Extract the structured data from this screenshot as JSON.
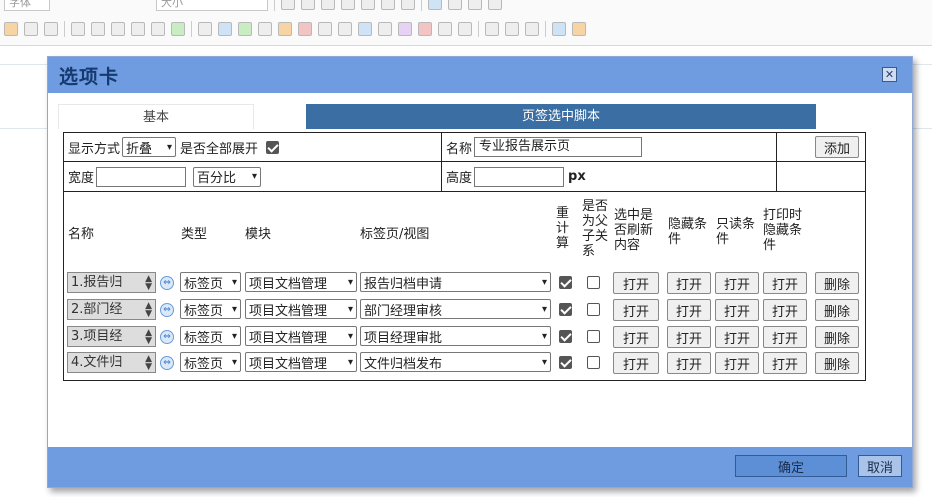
{
  "editor_toolbar": {
    "font_family_placeholder": "字体",
    "font_size_placeholder": "大小"
  },
  "dialog": {
    "title": "选项卡",
    "close_icon": "close-icon",
    "tabs": [
      {
        "label": "基本",
        "active": false
      },
      {
        "label": "页签选中脚本",
        "active": true
      }
    ],
    "settings": {
      "display_mode_label": "显示方式",
      "display_mode_value": "折叠",
      "expand_all_label": "是否全部展开",
      "expand_all_checked": true,
      "name_label": "名称",
      "name_value": "专业报告展示页",
      "add_label": "添加",
      "width_label": "宽度",
      "width_value": "",
      "width_unit_value": "百分比",
      "height_label": "高度",
      "height_value": "",
      "height_unit": "px"
    },
    "grid": {
      "headers": {
        "name": "名称",
        "type": "类型",
        "module": "模块",
        "tab_view": "标签页/视图",
        "recalc": "重\n计\n算",
        "parent_child": "是否\n为父\n子关\n系",
        "refresh_on_select": "选中是\n否刷新\n内容",
        "hide_cond": "隐藏条\n件",
        "readonly_cond": "只读条\n件",
        "print_hide_cond": "打印时\n隐藏条\n件"
      },
      "rows": [
        {
          "name": "1.报告归",
          "type": "标签页",
          "module": "项目文档管理",
          "view": "报告归档申请",
          "recalc": true,
          "parent_child": false,
          "open1": "打开",
          "open2": "打开",
          "open3": "打开",
          "open4": "打开",
          "delete": "删除"
        },
        {
          "name": "2.部门经",
          "type": "标签页",
          "module": "项目文档管理",
          "view": "部门经理审核",
          "recalc": true,
          "parent_child": false,
          "open1": "打开",
          "open2": "打开",
          "open3": "打开",
          "open4": "打开",
          "delete": "删除"
        },
        {
          "name": "3.项目经",
          "type": "标签页",
          "module": "项目文档管理",
          "view": "项目经理审批",
          "recalc": true,
          "parent_child": false,
          "open1": "打开",
          "open2": "打开",
          "open3": "打开",
          "open4": "打开",
          "delete": "删除"
        },
        {
          "name": "4.文件归",
          "type": "标签页",
          "module": "项目文档管理",
          "view": "文件归档发布",
          "recalc": true,
          "parent_child": false,
          "open1": "打开",
          "open2": "打开",
          "open3": "打开",
          "open4": "打开",
          "delete": "删除"
        }
      ]
    },
    "footer": {
      "ok_label": "确定",
      "cancel_label": "取消"
    },
    "colors": {
      "title_bar": "#6f9be0",
      "active_tab": "#3b6fa3",
      "ok_button": "#5c8fd6"
    }
  }
}
